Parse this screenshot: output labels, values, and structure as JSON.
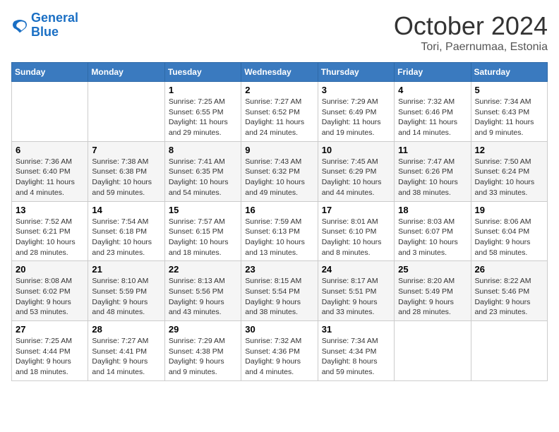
{
  "header": {
    "logo_line1": "General",
    "logo_line2": "Blue",
    "title": "October 2024",
    "subtitle": "Tori, Paernumaa, Estonia"
  },
  "weekdays": [
    "Sunday",
    "Monday",
    "Tuesday",
    "Wednesday",
    "Thursday",
    "Friday",
    "Saturday"
  ],
  "weeks": [
    [
      {
        "day": "",
        "sunrise": "",
        "sunset": "",
        "daylight": ""
      },
      {
        "day": "",
        "sunrise": "",
        "sunset": "",
        "daylight": ""
      },
      {
        "day": "1",
        "sunrise": "Sunrise: 7:25 AM",
        "sunset": "Sunset: 6:55 PM",
        "daylight": "Daylight: 11 hours and 29 minutes."
      },
      {
        "day": "2",
        "sunrise": "Sunrise: 7:27 AM",
        "sunset": "Sunset: 6:52 PM",
        "daylight": "Daylight: 11 hours and 24 minutes."
      },
      {
        "day": "3",
        "sunrise": "Sunrise: 7:29 AM",
        "sunset": "Sunset: 6:49 PM",
        "daylight": "Daylight: 11 hours and 19 minutes."
      },
      {
        "day": "4",
        "sunrise": "Sunrise: 7:32 AM",
        "sunset": "Sunset: 6:46 PM",
        "daylight": "Daylight: 11 hours and 14 minutes."
      },
      {
        "day": "5",
        "sunrise": "Sunrise: 7:34 AM",
        "sunset": "Sunset: 6:43 PM",
        "daylight": "Daylight: 11 hours and 9 minutes."
      }
    ],
    [
      {
        "day": "6",
        "sunrise": "Sunrise: 7:36 AM",
        "sunset": "Sunset: 6:40 PM",
        "daylight": "Daylight: 11 hours and 4 minutes."
      },
      {
        "day": "7",
        "sunrise": "Sunrise: 7:38 AM",
        "sunset": "Sunset: 6:38 PM",
        "daylight": "Daylight: 10 hours and 59 minutes."
      },
      {
        "day": "8",
        "sunrise": "Sunrise: 7:41 AM",
        "sunset": "Sunset: 6:35 PM",
        "daylight": "Daylight: 10 hours and 54 minutes."
      },
      {
        "day": "9",
        "sunrise": "Sunrise: 7:43 AM",
        "sunset": "Sunset: 6:32 PM",
        "daylight": "Daylight: 10 hours and 49 minutes."
      },
      {
        "day": "10",
        "sunrise": "Sunrise: 7:45 AM",
        "sunset": "Sunset: 6:29 PM",
        "daylight": "Daylight: 10 hours and 44 minutes."
      },
      {
        "day": "11",
        "sunrise": "Sunrise: 7:47 AM",
        "sunset": "Sunset: 6:26 PM",
        "daylight": "Daylight: 10 hours and 38 minutes."
      },
      {
        "day": "12",
        "sunrise": "Sunrise: 7:50 AM",
        "sunset": "Sunset: 6:24 PM",
        "daylight": "Daylight: 10 hours and 33 minutes."
      }
    ],
    [
      {
        "day": "13",
        "sunrise": "Sunrise: 7:52 AM",
        "sunset": "Sunset: 6:21 PM",
        "daylight": "Daylight: 10 hours and 28 minutes."
      },
      {
        "day": "14",
        "sunrise": "Sunrise: 7:54 AM",
        "sunset": "Sunset: 6:18 PM",
        "daylight": "Daylight: 10 hours and 23 minutes."
      },
      {
        "day": "15",
        "sunrise": "Sunrise: 7:57 AM",
        "sunset": "Sunset: 6:15 PM",
        "daylight": "Daylight: 10 hours and 18 minutes."
      },
      {
        "day": "16",
        "sunrise": "Sunrise: 7:59 AM",
        "sunset": "Sunset: 6:13 PM",
        "daylight": "Daylight: 10 hours and 13 minutes."
      },
      {
        "day": "17",
        "sunrise": "Sunrise: 8:01 AM",
        "sunset": "Sunset: 6:10 PM",
        "daylight": "Daylight: 10 hours and 8 minutes."
      },
      {
        "day": "18",
        "sunrise": "Sunrise: 8:03 AM",
        "sunset": "Sunset: 6:07 PM",
        "daylight": "Daylight: 10 hours and 3 minutes."
      },
      {
        "day": "19",
        "sunrise": "Sunrise: 8:06 AM",
        "sunset": "Sunset: 6:04 PM",
        "daylight": "Daylight: 9 hours and 58 minutes."
      }
    ],
    [
      {
        "day": "20",
        "sunrise": "Sunrise: 8:08 AM",
        "sunset": "Sunset: 6:02 PM",
        "daylight": "Daylight: 9 hours and 53 minutes."
      },
      {
        "day": "21",
        "sunrise": "Sunrise: 8:10 AM",
        "sunset": "Sunset: 5:59 PM",
        "daylight": "Daylight: 9 hours and 48 minutes."
      },
      {
        "day": "22",
        "sunrise": "Sunrise: 8:13 AM",
        "sunset": "Sunset: 5:56 PM",
        "daylight": "Daylight: 9 hours and 43 minutes."
      },
      {
        "day": "23",
        "sunrise": "Sunrise: 8:15 AM",
        "sunset": "Sunset: 5:54 PM",
        "daylight": "Daylight: 9 hours and 38 minutes."
      },
      {
        "day": "24",
        "sunrise": "Sunrise: 8:17 AM",
        "sunset": "Sunset: 5:51 PM",
        "daylight": "Daylight: 9 hours and 33 minutes."
      },
      {
        "day": "25",
        "sunrise": "Sunrise: 8:20 AM",
        "sunset": "Sunset: 5:49 PM",
        "daylight": "Daylight: 9 hours and 28 minutes."
      },
      {
        "day": "26",
        "sunrise": "Sunrise: 8:22 AM",
        "sunset": "Sunset: 5:46 PM",
        "daylight": "Daylight: 9 hours and 23 minutes."
      }
    ],
    [
      {
        "day": "27",
        "sunrise": "Sunrise: 7:25 AM",
        "sunset": "Sunset: 4:44 PM",
        "daylight": "Daylight: 9 hours and 18 minutes."
      },
      {
        "day": "28",
        "sunrise": "Sunrise: 7:27 AM",
        "sunset": "Sunset: 4:41 PM",
        "daylight": "Daylight: 9 hours and 14 minutes."
      },
      {
        "day": "29",
        "sunrise": "Sunrise: 7:29 AM",
        "sunset": "Sunset: 4:38 PM",
        "daylight": "Daylight: 9 hours and 9 minutes."
      },
      {
        "day": "30",
        "sunrise": "Sunrise: 7:32 AM",
        "sunset": "Sunset: 4:36 PM",
        "daylight": "Daylight: 9 hours and 4 minutes."
      },
      {
        "day": "31",
        "sunrise": "Sunrise: 7:34 AM",
        "sunset": "Sunset: 4:34 PM",
        "daylight": "Daylight: 8 hours and 59 minutes."
      },
      {
        "day": "",
        "sunrise": "",
        "sunset": "",
        "daylight": ""
      },
      {
        "day": "",
        "sunrise": "",
        "sunset": "",
        "daylight": ""
      }
    ]
  ]
}
